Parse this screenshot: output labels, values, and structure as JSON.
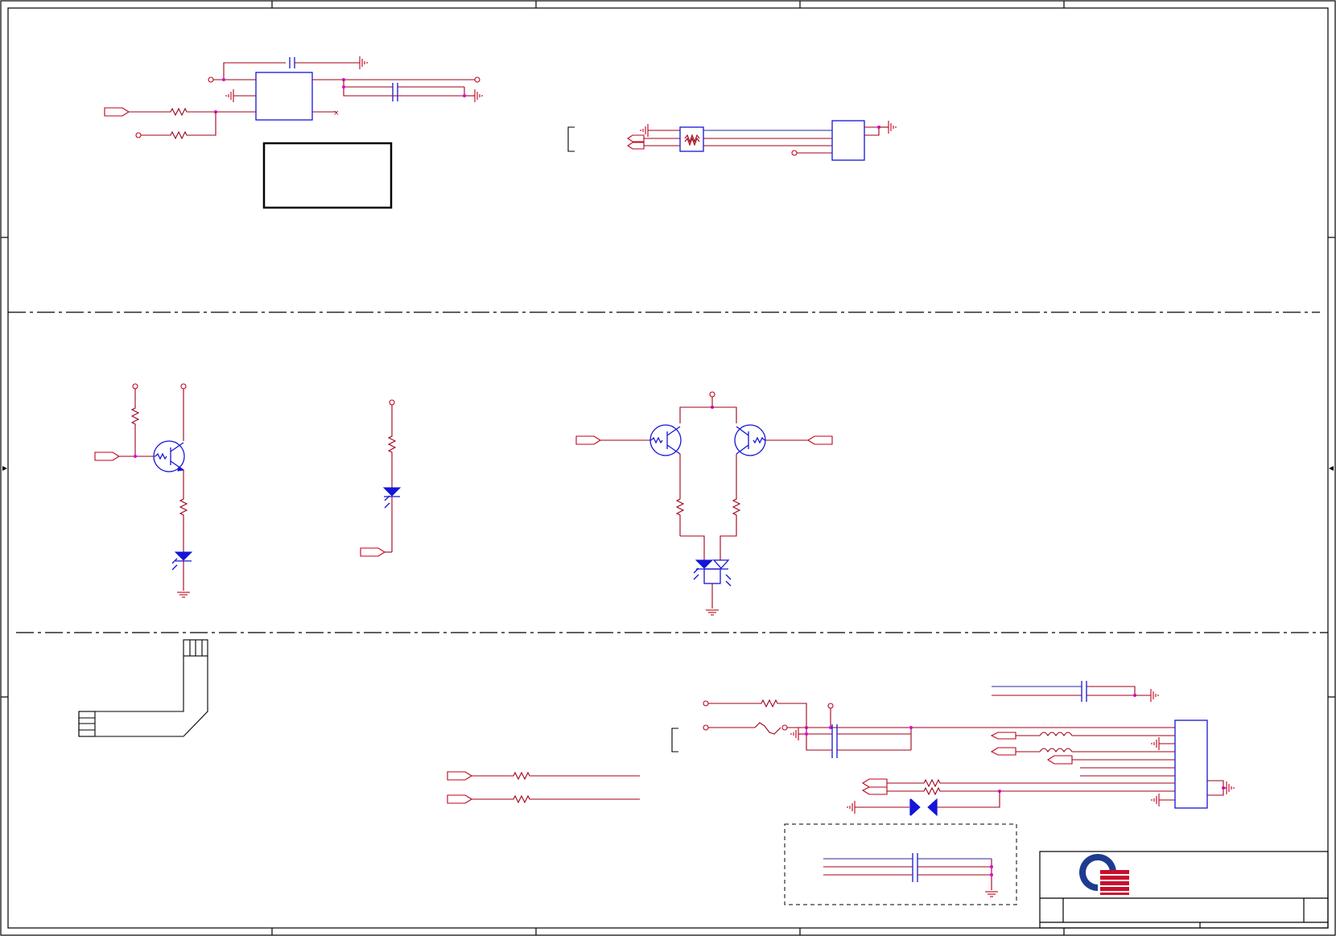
{
  "sheet": {
    "colors": {
      "frame": "#000000",
      "wire": "#a00016",
      "component": "#1515d8",
      "junction": "#e000e0"
    }
  },
  "sections": [
    {
      "id": "top",
      "components": [
        "regulator-ic",
        "clock-connector-ic",
        "common-mode-choke"
      ]
    },
    {
      "id": "middle",
      "components": [
        "led-driver-transistor",
        "indicator-led",
        "dual-led-driver"
      ]
    },
    {
      "id": "bottom",
      "components": [
        "ribbon-cable",
        "series-resistors",
        "usb-connector",
        "esd-diode",
        "filter-capacitor-block"
      ]
    }
  ],
  "title_block": {
    "logo": "quanta-logo"
  }
}
